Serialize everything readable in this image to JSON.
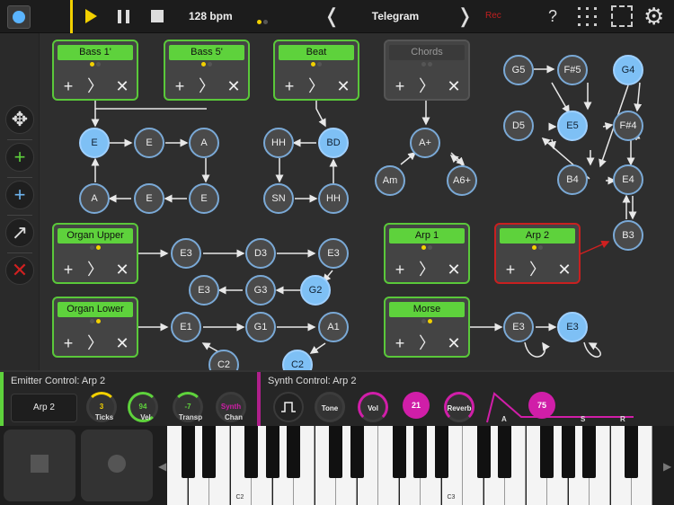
{
  "topbar": {
    "tempo": "128 bpm",
    "song_title": "Telegram",
    "record_label": "Rec",
    "help_label": "?",
    "prev_label": "❬",
    "next_label": "❭",
    "gear_label": "⚙"
  },
  "toolbar": {
    "move_label": "✥",
    "add_green_label": "+",
    "add_blue_label": "+",
    "connect_label": "↗",
    "delete_label": "✕"
  },
  "emitters": [
    {
      "title": "Bass 1'"
    },
    {
      "title": "Bass 5'"
    },
    {
      "title": "Beat"
    },
    {
      "title": "Chords"
    },
    {
      "title": "Organ Upper"
    },
    {
      "title": "Organ Lower"
    },
    {
      "title": "Arp 1"
    },
    {
      "title": "Arp 2"
    },
    {
      "title": "Morse"
    }
  ],
  "emitter_buttons": {
    "add": "+",
    "next": "〉",
    "remove": "✕"
  },
  "nodes": [
    "E",
    "E",
    "A",
    "A",
    "E",
    "E",
    "HH",
    "BD",
    "SN",
    "HH",
    "A+",
    "Am",
    "A6+",
    "G5",
    "F#5",
    "G4",
    "D5",
    "E5",
    "F#4",
    "B4",
    "E4",
    "B3",
    "E3",
    "D3",
    "E3",
    "E3",
    "G3",
    "G2",
    "E1",
    "G1",
    "A1",
    "C2",
    "C2",
    "E3",
    "E3"
  ],
  "emitter_control": {
    "title": "Emitter Control: Arp 2",
    "selector": "Arp 2",
    "ticks": {
      "value": "3",
      "label": "Ticks"
    },
    "vel": {
      "value": "94",
      "label": "Vel"
    },
    "transp": {
      "value": "-7",
      "label": "Transp"
    },
    "chan": {
      "value": "Synth",
      "label": "Chan"
    }
  },
  "synth_control": {
    "title": "Synth Control: Arp 2",
    "tone_label": "Tone",
    "vol_label": "Vol",
    "level_value": "21",
    "reverb_label": "Reverb",
    "a_label": "A",
    "adsr_value": "75",
    "s_label": "S",
    "r_label": "R"
  },
  "keyboard": {
    "c2_label": "C2",
    "c3_label": "C3",
    "left_arrow": "◀",
    "right_arrow": "▶"
  },
  "colors": {
    "accent_green": "#5ed23c",
    "accent_yellow": "#f2d000",
    "node_blue": "#7ec0f5",
    "synth_pink": "#d01ea8",
    "select_red": "#c82020"
  }
}
